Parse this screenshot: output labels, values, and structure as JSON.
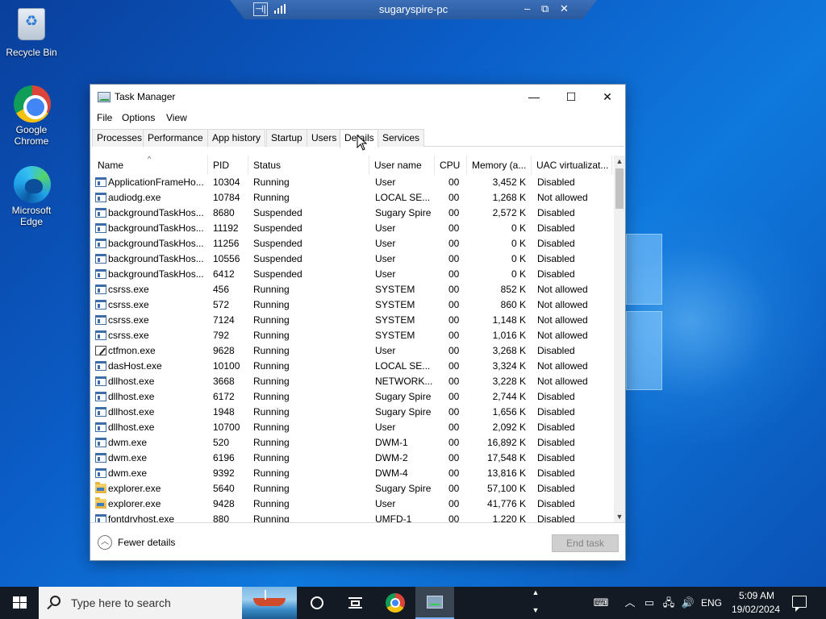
{
  "rdp": {
    "title": "sugaryspire-pc",
    "pin_glyph": "⊣|",
    "min": "–",
    "restore": "⧉",
    "close": "✕"
  },
  "desktop": {
    "icons": [
      {
        "label": "Recycle Bin",
        "icon": "recycle-bin-icon"
      },
      {
        "label": "Google Chrome",
        "icon": "chrome-icon"
      },
      {
        "label": "Microsoft Edge",
        "icon": "edge-icon"
      }
    ]
  },
  "window": {
    "title": "Task Manager",
    "controls": {
      "minimize": "—",
      "maximize": "☐",
      "close": "✕"
    },
    "menu": [
      "File",
      "Options",
      "View"
    ],
    "tabs": [
      "Processes",
      "Performance",
      "App history",
      "Startup",
      "Users",
      "Details",
      "Services"
    ],
    "active_tab": "Details"
  },
  "table": {
    "sort_caret": "^",
    "columns": [
      "Name",
      "PID",
      "Status",
      "User name",
      "CPU",
      "Memory (a...",
      "UAC virtualizat..."
    ],
    "rows": [
      {
        "icon": "app",
        "name": "ApplicationFrameHo...",
        "pid": "10304",
        "status": "Running",
        "user": "User",
        "cpu": "00",
        "memory": "3,452 K",
        "uac": "Disabled"
      },
      {
        "icon": "app",
        "name": "audiodg.exe",
        "pid": "10784",
        "status": "Running",
        "user": "LOCAL SE...",
        "cpu": "00",
        "memory": "1,268 K",
        "uac": "Not allowed"
      },
      {
        "icon": "app",
        "name": "backgroundTaskHos...",
        "pid": "8680",
        "status": "Suspended",
        "user": "Sugary Spire",
        "cpu": "00",
        "memory": "2,572 K",
        "uac": "Disabled"
      },
      {
        "icon": "app",
        "name": "backgroundTaskHos...",
        "pid": "11192",
        "status": "Suspended",
        "user": "User",
        "cpu": "00",
        "memory": "0 K",
        "uac": "Disabled"
      },
      {
        "icon": "app",
        "name": "backgroundTaskHos...",
        "pid": "11256",
        "status": "Suspended",
        "user": "User",
        "cpu": "00",
        "memory": "0 K",
        "uac": "Disabled"
      },
      {
        "icon": "app",
        "name": "backgroundTaskHos...",
        "pid": "10556",
        "status": "Suspended",
        "user": "User",
        "cpu": "00",
        "memory": "0 K",
        "uac": "Disabled"
      },
      {
        "icon": "app",
        "name": "backgroundTaskHos...",
        "pid": "6412",
        "status": "Suspended",
        "user": "User",
        "cpu": "00",
        "memory": "0 K",
        "uac": "Disabled"
      },
      {
        "icon": "app",
        "name": "csrss.exe",
        "pid": "456",
        "status": "Running",
        "user": "SYSTEM",
        "cpu": "00",
        "memory": "852 K",
        "uac": "Not allowed"
      },
      {
        "icon": "app",
        "name": "csrss.exe",
        "pid": "572",
        "status": "Running",
        "user": "SYSTEM",
        "cpu": "00",
        "memory": "860 K",
        "uac": "Not allowed"
      },
      {
        "icon": "app",
        "name": "csrss.exe",
        "pid": "7124",
        "status": "Running",
        "user": "SYSTEM",
        "cpu": "00",
        "memory": "1,148 K",
        "uac": "Not allowed"
      },
      {
        "icon": "app",
        "name": "csrss.exe",
        "pid": "792",
        "status": "Running",
        "user": "SYSTEM",
        "cpu": "00",
        "memory": "1,016 K",
        "uac": "Not allowed"
      },
      {
        "icon": "pen",
        "name": "ctfmon.exe",
        "pid": "9628",
        "status": "Running",
        "user": "User",
        "cpu": "00",
        "memory": "3,268 K",
        "uac": "Disabled"
      },
      {
        "icon": "app",
        "name": "dasHost.exe",
        "pid": "10100",
        "status": "Running",
        "user": "LOCAL SE...",
        "cpu": "00",
        "memory": "3,324 K",
        "uac": "Not allowed"
      },
      {
        "icon": "app",
        "name": "dllhost.exe",
        "pid": "3668",
        "status": "Running",
        "user": "NETWORK...",
        "cpu": "00",
        "memory": "3,228 K",
        "uac": "Not allowed"
      },
      {
        "icon": "app",
        "name": "dllhost.exe",
        "pid": "6172",
        "status": "Running",
        "user": "Sugary Spire",
        "cpu": "00",
        "memory": "2,744 K",
        "uac": "Disabled"
      },
      {
        "icon": "app",
        "name": "dllhost.exe",
        "pid": "1948",
        "status": "Running",
        "user": "Sugary Spire",
        "cpu": "00",
        "memory": "1,656 K",
        "uac": "Disabled"
      },
      {
        "icon": "app",
        "name": "dllhost.exe",
        "pid": "10700",
        "status": "Running",
        "user": "User",
        "cpu": "00",
        "memory": "2,092 K",
        "uac": "Disabled"
      },
      {
        "icon": "app",
        "name": "dwm.exe",
        "pid": "520",
        "status": "Running",
        "user": "DWM-1",
        "cpu": "00",
        "memory": "16,892 K",
        "uac": "Disabled"
      },
      {
        "icon": "app",
        "name": "dwm.exe",
        "pid": "6196",
        "status": "Running",
        "user": "DWM-2",
        "cpu": "00",
        "memory": "17,548 K",
        "uac": "Disabled"
      },
      {
        "icon": "app",
        "name": "dwm.exe",
        "pid": "9392",
        "status": "Running",
        "user": "DWM-4",
        "cpu": "00",
        "memory": "13,816 K",
        "uac": "Disabled"
      },
      {
        "icon": "folder",
        "name": "explorer.exe",
        "pid": "5640",
        "status": "Running",
        "user": "Sugary Spire",
        "cpu": "00",
        "memory": "57,100 K",
        "uac": "Disabled"
      },
      {
        "icon": "folder",
        "name": "explorer.exe",
        "pid": "9428",
        "status": "Running",
        "user": "User",
        "cpu": "00",
        "memory": "41,776 K",
        "uac": "Disabled"
      },
      {
        "icon": "app",
        "name": "fontdrvhost.exe",
        "pid": "880",
        "status": "Running",
        "user": "UMFD-1",
        "cpu": "00",
        "memory": "1,220 K",
        "uac": "Disabled"
      }
    ]
  },
  "footer": {
    "fewer_details": "Fewer details",
    "end_task": "End task"
  },
  "taskbar": {
    "search_placeholder": "Type here to search",
    "language": "ENG",
    "time": "5:09 AM",
    "date": "19/02/2024",
    "colors": {
      "taskbar": "#131a24",
      "desktop": "#0b5dc7"
    }
  }
}
